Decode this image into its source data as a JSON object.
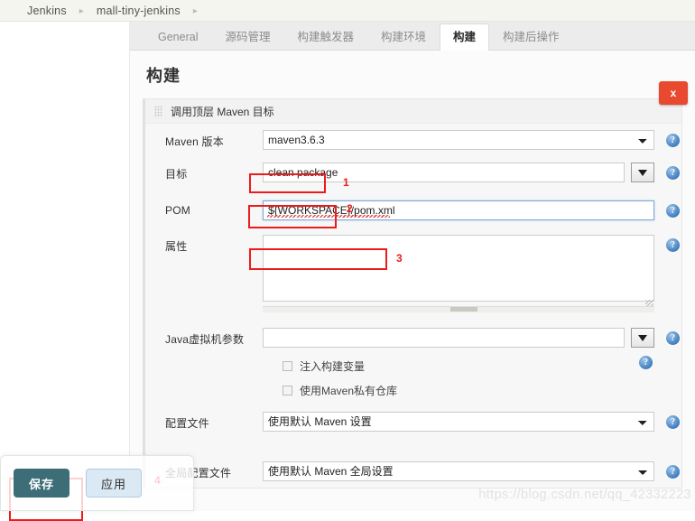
{
  "breadcrumb": {
    "items": [
      "Jenkins",
      "mall-tiny-jenkins"
    ],
    "separator": "▸"
  },
  "tabs": [
    {
      "label": "General",
      "active": false
    },
    {
      "label": "源码管理",
      "active": false
    },
    {
      "label": "构建触发器",
      "active": false
    },
    {
      "label": "构建环境",
      "active": false
    },
    {
      "label": "构建",
      "active": true
    },
    {
      "label": "构建后操作",
      "active": false
    }
  ],
  "page": {
    "title": "构建",
    "builder_title": "调用顶层 Maven 目标",
    "delete_label": "x"
  },
  "fields": {
    "maven_version": {
      "label": "Maven 版本",
      "value": "maven3.6.3",
      "options": [
        "maven3.6.3"
      ]
    },
    "goals": {
      "label": "目标",
      "value": "clean package",
      "placeholder": ""
    },
    "pom": {
      "label": "POM",
      "value": "${WORKSPACE}/pom.xml",
      "placeholder": ""
    },
    "properties": {
      "label": "属性",
      "value": "",
      "placeholder": ""
    },
    "jvm_options": {
      "label": "Java虚拟机参数",
      "value": "",
      "placeholder": ""
    },
    "inject_build_vars": {
      "label": "注入构建变量",
      "checked": false
    },
    "private_repository": {
      "label": "使用Maven私有仓库",
      "checked": false
    },
    "settings_file": {
      "label": "配置文件",
      "value": "使用默认 Maven 设置",
      "options": [
        "使用默认 Maven 设置"
      ]
    },
    "global_settings_file": {
      "label": "全局配置文件",
      "value": "使用默认 Maven 全局设置",
      "options": [
        "使用默认 Maven 全局设置"
      ]
    }
  },
  "help": {
    "glyph": "?"
  },
  "annotations": {
    "one": "1",
    "two": "2",
    "three": "3",
    "four": "4"
  },
  "save_bar": {
    "save_label": "保存",
    "apply_label": "应用"
  },
  "watermark": "https://blog.csdn.net/qq_42332223",
  "colors": {
    "accent_teal": "#3d6e78",
    "danger_red": "#e8492f",
    "annotation_red": "#ee1b1b",
    "help_blue": "#3f7fc0"
  }
}
